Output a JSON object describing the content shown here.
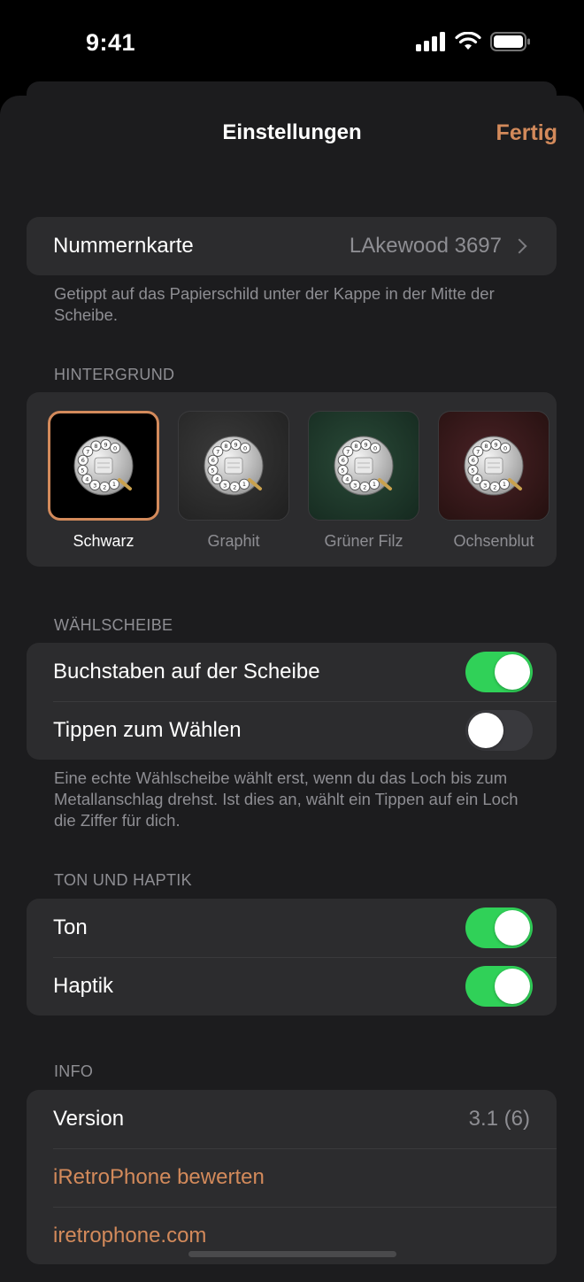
{
  "status": {
    "time": "9:41"
  },
  "nav": {
    "title": "Einstellungen",
    "done": "Fertig"
  },
  "number_card": {
    "label": "Nummernkarte",
    "value": "LAkewood 3697",
    "footnote": "Getippt auf das Papierschild unter der Kappe in der Mitte der Scheibe."
  },
  "background": {
    "header": "HINTERGRUND",
    "themes": [
      {
        "label": "Schwarz",
        "selected": true,
        "color": "#000000"
      },
      {
        "label": "Graphit",
        "selected": false,
        "color": "#2a2a2a"
      },
      {
        "label": "Grüner Filz",
        "selected": false,
        "color": "#1d3a2b"
      },
      {
        "label": "Ochsenblut",
        "selected": false,
        "color": "#3a1a1d"
      }
    ]
  },
  "dial": {
    "header": "WÄHLSCHEIBE",
    "letters": {
      "label": "Buchstaben auf der Scheibe",
      "on": true
    },
    "tap": {
      "label": "Tippen zum Wählen",
      "on": false
    },
    "footnote": "Eine echte Wählscheibe wählt erst, wenn du das Loch bis zum Metallanschlag drehst. Ist dies an, wählt ein Tippen auf ein Loch die Ziffer für dich."
  },
  "sound": {
    "header": "TON UND HAPTIK",
    "tone": {
      "label": "Ton",
      "on": true
    },
    "haptics": {
      "label": "Haptik",
      "on": true
    }
  },
  "info": {
    "header": "INFO",
    "version_label": "Version",
    "version_value": "3.1 (6)",
    "rate": "iRetroPhone bewerten",
    "website": "iretrophone.com"
  },
  "colors": {
    "accent": "#d38a5b",
    "toggle_on": "#30d158"
  },
  "dial_digits": [
    "1",
    "2",
    "3",
    "4",
    "5",
    "6",
    "7",
    "8",
    "9",
    "0"
  ]
}
